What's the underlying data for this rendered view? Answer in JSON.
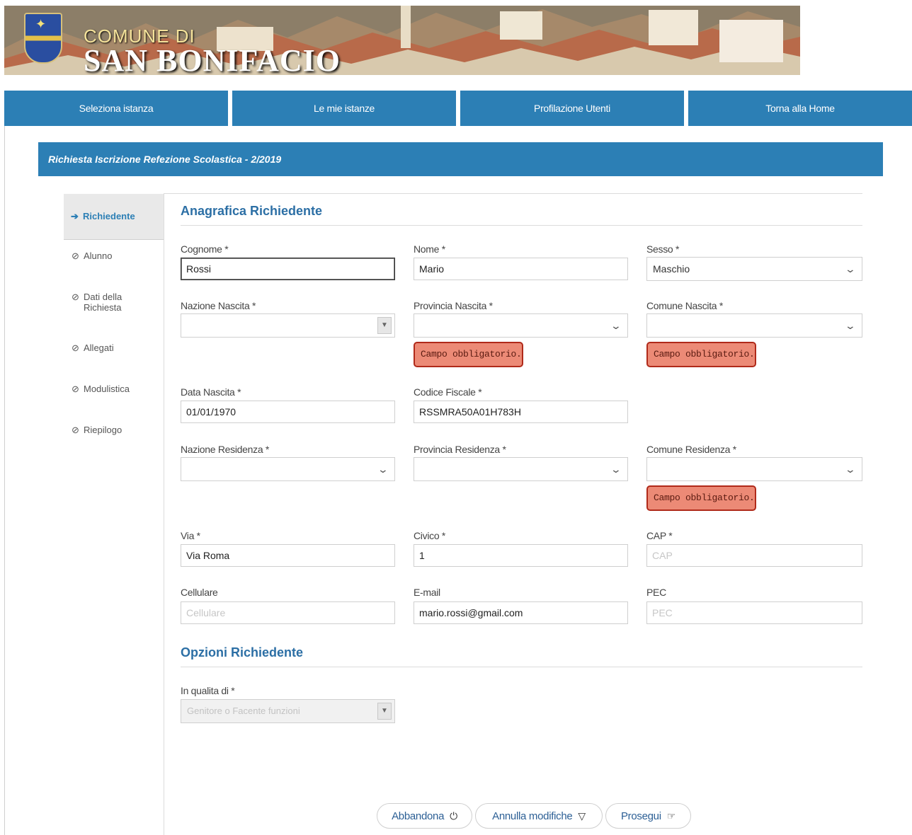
{
  "banner": {
    "line1": "COMUNE DI",
    "line2": "SAN BONIFACIO"
  },
  "nav": [
    "Seleziona istanza",
    "Le mie istanze",
    "Profilazione Utenti",
    "Torna alla Home"
  ],
  "title": "Richiesta Iscrizione Refezione Scolastica - 2/2019",
  "sidebar": [
    {
      "label": "Richiedente",
      "icon": "arrow-right-icon"
    },
    {
      "label": "Alunno",
      "icon": "ban-icon"
    },
    {
      "label": "Dati della Richiesta",
      "icon": "ban-icon"
    },
    {
      "label": "Allegati",
      "icon": "ban-icon"
    },
    {
      "label": "Modulistica",
      "icon": "ban-icon"
    },
    {
      "label": "Riepilogo",
      "icon": "ban-icon"
    }
  ],
  "section1": "Anagrafica Richiedente",
  "section2": "Opzioni Richiedente",
  "fields": {
    "cognome": {
      "label": "Cognome *",
      "value": "Rossi"
    },
    "nome": {
      "label": "Nome *",
      "value": "Mario"
    },
    "sesso": {
      "label": "Sesso *",
      "value": "Maschio"
    },
    "nazione_nascita": {
      "label": "Nazione Nascita *",
      "value": ""
    },
    "provincia_nascita": {
      "label": "Provincia Nascita *",
      "value": ""
    },
    "comune_nascita": {
      "label": "Comune Nascita *",
      "value": ""
    },
    "data_nascita": {
      "label": "Data Nascita *",
      "value": "01/01/1970"
    },
    "codice_fiscale": {
      "label": "Codice Fiscale *",
      "value": "RSSMRA50A01H783H"
    },
    "nazione_residenza": {
      "label": "Nazione Residenza *",
      "value": ""
    },
    "provincia_residenza": {
      "label": "Provincia Residenza *",
      "value": ""
    },
    "comune_residenza": {
      "label": "Comune Residenza *",
      "value": ""
    },
    "via": {
      "label": "Via *",
      "value": "Via Roma"
    },
    "civico": {
      "label": "Civico *",
      "value": "1"
    },
    "cap": {
      "label": "CAP *",
      "value": "",
      "placeholder": "CAP"
    },
    "cellulare": {
      "label": "Cellulare",
      "value": "",
      "placeholder": "Cellulare"
    },
    "email": {
      "label": "E-mail",
      "value": "mario.rossi@gmail.com"
    },
    "pec": {
      "label": "PEC",
      "value": "",
      "placeholder": "PEC"
    },
    "qualita": {
      "label": "In qualita di *",
      "value": "Genitore o Facente funzioni"
    }
  },
  "error_text": "Campo obbligatorio.",
  "buttons": {
    "abbandona": "Abbandona",
    "annulla": "Annulla modifiche",
    "prosegui": "Prosegui"
  },
  "colors": {
    "accent": "#2c7fb5",
    "error_bg": "#ec8a76",
    "error_border": "#b02a1a"
  }
}
